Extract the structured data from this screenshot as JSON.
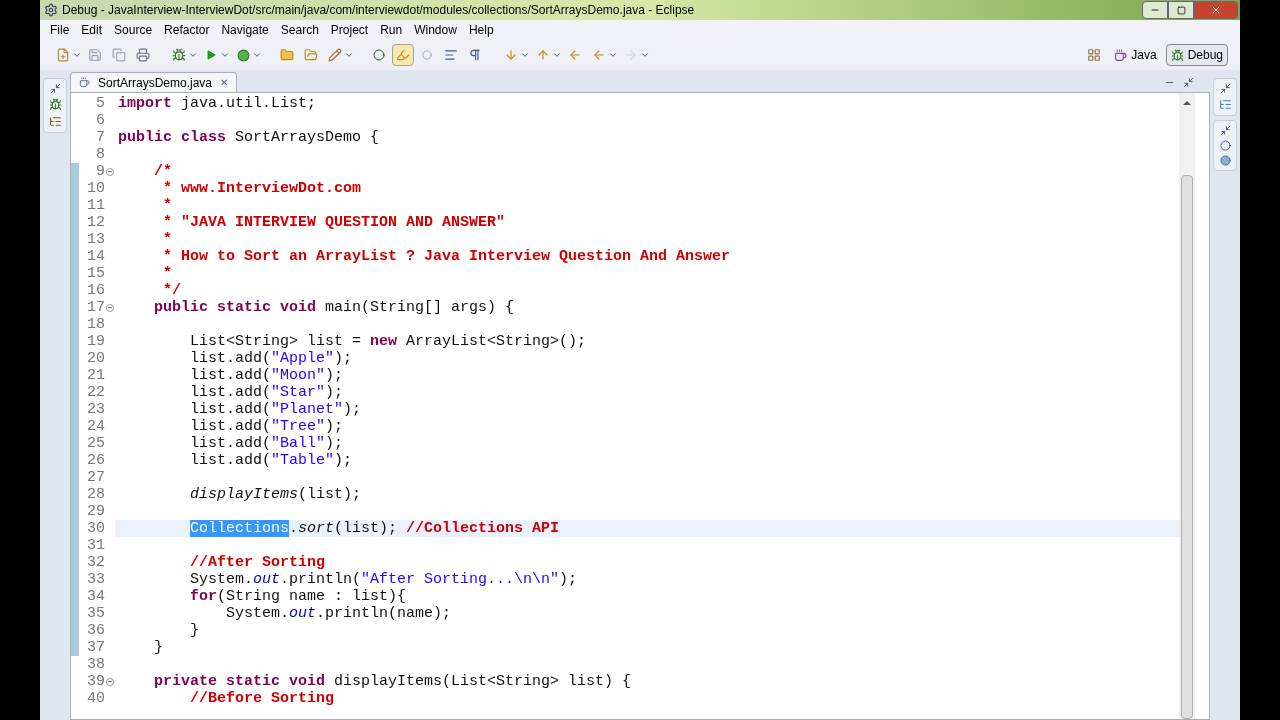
{
  "window": {
    "title": "Debug - JavaInterview-InterviewDot/src/main/java/com/interviewdot/modules/collections/SortArraysDemo.java - Eclipse"
  },
  "menu": [
    "File",
    "Edit",
    "Source",
    "Refactor",
    "Navigate",
    "Search",
    "Project",
    "Run",
    "Window",
    "Help"
  ],
  "perspectives": [
    {
      "label": "Java",
      "selected": false
    },
    {
      "label": "Debug",
      "selected": true
    }
  ],
  "editor_tab": {
    "label": "SortArraysDemo.java",
    "close": "✕"
  },
  "lines": [
    {
      "n": "5",
      "fold": false,
      "changed": false,
      "current": false,
      "tokens": [
        {
          "kind": "keyword",
          "text": "import"
        },
        {
          "kind": "plain",
          "text": " java.util.List;"
        }
      ]
    },
    {
      "n": "6",
      "fold": false,
      "changed": false,
      "current": false
    },
    {
      "n": "7",
      "fold": false,
      "changed": false,
      "current": false,
      "tokens": [
        {
          "kind": "keyword",
          "text": "public class"
        },
        {
          "kind": "plain",
          "text": " SortArraysDemo {"
        }
      ]
    },
    {
      "n": "8",
      "fold": false,
      "changed": false,
      "current": false
    },
    {
      "n": "9",
      "fold": true,
      "changed": true,
      "current": false,
      "tokens": [
        {
          "kind": "comment",
          "text": "    /*"
        }
      ]
    },
    {
      "n": "10",
      "fold": false,
      "changed": true,
      "current": false,
      "tokens": [
        {
          "kind": "comment",
          "text": "     * www.InterviewDot.com"
        }
      ]
    },
    {
      "n": "11",
      "fold": false,
      "changed": true,
      "current": false,
      "tokens": [
        {
          "kind": "comment",
          "text": "     *"
        }
      ]
    },
    {
      "n": "12",
      "fold": false,
      "changed": true,
      "current": false,
      "tokens": [
        {
          "kind": "comment",
          "text": "     * \"JAVA INTERVIEW QUESTION AND ANSWER\""
        }
      ]
    },
    {
      "n": "13",
      "fold": false,
      "changed": true,
      "current": false,
      "tokens": [
        {
          "kind": "comment",
          "text": "     *"
        }
      ]
    },
    {
      "n": "14",
      "fold": false,
      "changed": true,
      "current": false,
      "tokens": [
        {
          "kind": "comment",
          "text": "     * How to Sort an ArrayList ? Java Interview Question And Answer"
        }
      ]
    },
    {
      "n": "15",
      "fold": false,
      "changed": true,
      "current": false,
      "tokens": [
        {
          "kind": "comment",
          "text": "     *"
        }
      ]
    },
    {
      "n": "16",
      "fold": false,
      "changed": true,
      "current": false,
      "tokens": [
        {
          "kind": "comment",
          "text": "     */"
        }
      ]
    },
    {
      "n": "17",
      "fold": true,
      "changed": true,
      "current": false,
      "tokens": [
        {
          "kind": "keyword",
          "text": "    public static void"
        },
        {
          "kind": "plain",
          "text": " main(String[] args) {"
        }
      ]
    },
    {
      "n": "18",
      "fold": false,
      "changed": true,
      "current": false
    },
    {
      "n": "19",
      "fold": false,
      "changed": true,
      "current": false,
      "tokens": [
        {
          "kind": "plain",
          "text": "        List<String> list = "
        },
        {
          "kind": "keyword",
          "text": "new"
        },
        {
          "kind": "plain",
          "text": " ArrayList<String>();"
        }
      ]
    },
    {
      "n": "20",
      "fold": false,
      "changed": true,
      "current": false,
      "tokens": [
        {
          "kind": "plain",
          "text": "        list.add("
        },
        {
          "kind": "string",
          "text": "\"Apple\""
        },
        {
          "kind": "plain",
          "text": ");"
        }
      ]
    },
    {
      "n": "21",
      "fold": false,
      "changed": true,
      "current": false,
      "tokens": [
        {
          "kind": "plain",
          "text": "        list.add("
        },
        {
          "kind": "string",
          "text": "\"Moon\""
        },
        {
          "kind": "plain",
          "text": ");"
        }
      ]
    },
    {
      "n": "22",
      "fold": false,
      "changed": true,
      "current": false,
      "tokens": [
        {
          "kind": "plain",
          "text": "        list.add("
        },
        {
          "kind": "string",
          "text": "\"Star\""
        },
        {
          "kind": "plain",
          "text": ");"
        }
      ]
    },
    {
      "n": "23",
      "fold": false,
      "changed": true,
      "current": false,
      "tokens": [
        {
          "kind": "plain",
          "text": "        list.add("
        },
        {
          "kind": "string",
          "text": "\"Planet\""
        },
        {
          "kind": "plain",
          "text": ");"
        }
      ]
    },
    {
      "n": "24",
      "fold": false,
      "changed": true,
      "current": false,
      "tokens": [
        {
          "kind": "plain",
          "text": "        list.add("
        },
        {
          "kind": "string",
          "text": "\"Tree\""
        },
        {
          "kind": "plain",
          "text": ");"
        }
      ]
    },
    {
      "n": "25",
      "fold": false,
      "changed": true,
      "current": false,
      "tokens": [
        {
          "kind": "plain",
          "text": "        list.add("
        },
        {
          "kind": "string",
          "text": "\"Ball\""
        },
        {
          "kind": "plain",
          "text": ");"
        }
      ]
    },
    {
      "n": "26",
      "fold": false,
      "changed": true,
      "current": false,
      "tokens": [
        {
          "kind": "plain",
          "text": "        list.add("
        },
        {
          "kind": "string",
          "text": "\"Table\""
        },
        {
          "kind": "plain",
          "text": ");"
        }
      ]
    },
    {
      "n": "27",
      "fold": false,
      "changed": true,
      "current": false
    },
    {
      "n": "28",
      "fold": false,
      "changed": true,
      "current": false,
      "tokens": [
        {
          "kind": "italic",
          "text": "        displayItems"
        },
        {
          "kind": "plain",
          "text": "(list);"
        }
      ]
    },
    {
      "n": "29",
      "fold": false,
      "changed": true,
      "current": false
    },
    {
      "n": "30",
      "fold": false,
      "changed": true,
      "current": true,
      "tokens": [
        {
          "kind": "selected",
          "text": "Collections"
        },
        {
          "kind": "plain",
          "text": "."
        },
        {
          "kind": "italic",
          "text": "sort"
        },
        {
          "kind": "plain",
          "text": "(list); "
        },
        {
          "kind": "comment",
          "text": "//Collections API"
        }
      ]
    },
    {
      "n": "31",
      "fold": false,
      "changed": true,
      "current": false
    },
    {
      "n": "32",
      "fold": false,
      "changed": true,
      "current": false,
      "tokens": [
        {
          "kind": "comment",
          "text": "        //After Sorting"
        }
      ]
    },
    {
      "n": "33",
      "fold": false,
      "changed": true,
      "current": false,
      "tokens": [
        {
          "kind": "plain",
          "text": "        System."
        },
        {
          "kind": "field",
          "text": "out"
        },
        {
          "kind": "plain",
          "text": ".println("
        },
        {
          "kind": "string",
          "text": "\"After Sorting...\\n\\n\""
        },
        {
          "kind": "plain",
          "text": ");"
        }
      ]
    },
    {
      "n": "34",
      "fold": false,
      "changed": true,
      "current": false,
      "tokens": [
        {
          "kind": "keyword",
          "text": "        for"
        },
        {
          "kind": "plain",
          "text": "(String name : list){"
        }
      ]
    },
    {
      "n": "35",
      "fold": false,
      "changed": true,
      "current": false,
      "tokens": [
        {
          "kind": "plain",
          "text": "            System."
        },
        {
          "kind": "field",
          "text": "out"
        },
        {
          "kind": "plain",
          "text": ".println(name);"
        }
      ]
    },
    {
      "n": "36",
      "fold": false,
      "changed": true,
      "current": false,
      "tokens": [
        {
          "kind": "plain",
          "text": "        }"
        }
      ]
    },
    {
      "n": "37",
      "fold": false,
      "changed": true,
      "current": false,
      "tokens": [
        {
          "kind": "plain",
          "text": "    }"
        }
      ]
    },
    {
      "n": "38",
      "fold": false,
      "changed": false,
      "current": false
    },
    {
      "n": "39",
      "fold": true,
      "changed": false,
      "current": false,
      "tokens": [
        {
          "kind": "keyword",
          "text": "    private static void"
        },
        {
          "kind": "plain",
          "text": " displayItems(List<String> list) {"
        }
      ]
    },
    {
      "n": "40",
      "fold": false,
      "changed": false,
      "current": false,
      "tokens": [
        {
          "kind": "comment",
          "text": "        //Before Sorting"
        }
      ]
    }
  ]
}
